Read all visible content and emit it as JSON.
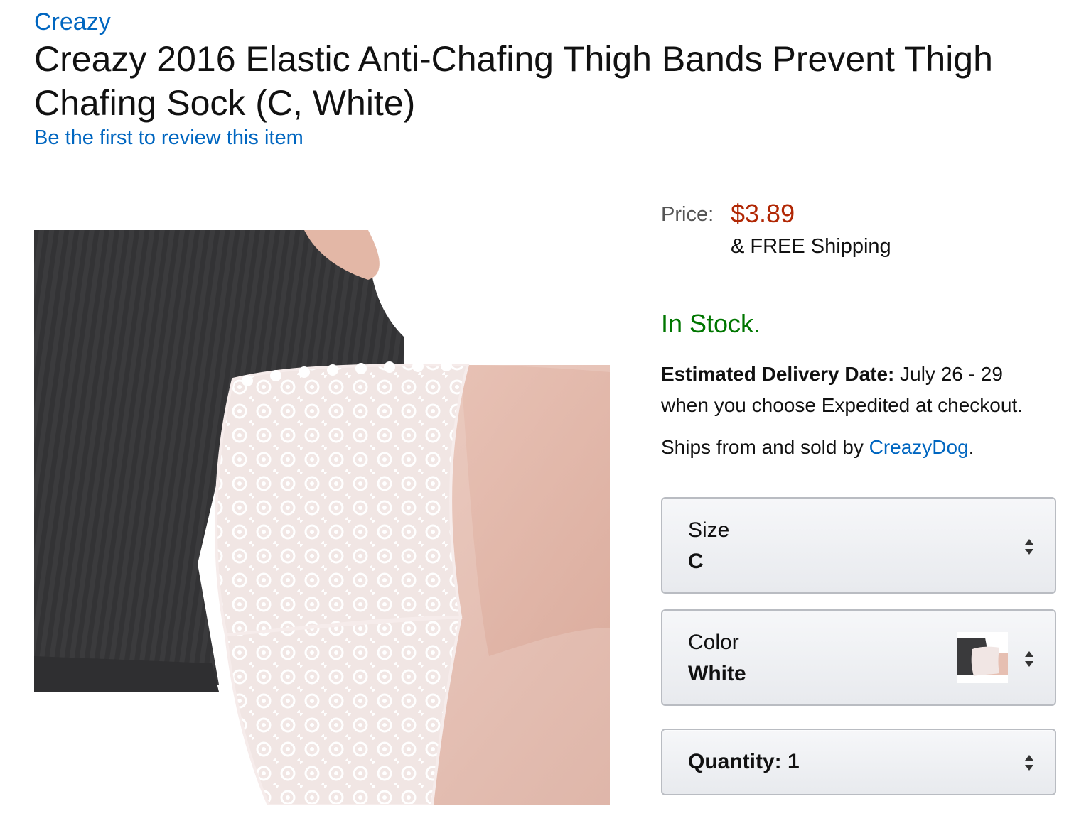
{
  "product": {
    "brand": "Creazy",
    "title": "Creazy 2016 Elastic Anti-Chafing Thigh Bands Prevent Thigh Chafing Sock (C, White)",
    "review_link": "Be the first to review this item",
    "image_alt": "lace thigh band on leg"
  },
  "buybox": {
    "price_label": "Price:",
    "price": "$3.89",
    "shipping": "& FREE Shipping",
    "stock": "In Stock.",
    "delivery_label": "Estimated Delivery Date:",
    "delivery_dates": "July 26 - 29",
    "delivery_note": "when you choose Expedited at checkout.",
    "seller_prefix": "Ships from and sold by",
    "seller_name": "CreazyDog",
    "seller_suffix": "."
  },
  "options": {
    "size": {
      "label": "Size",
      "value": "C"
    },
    "color": {
      "label": "Color",
      "value": "White"
    },
    "quantity": {
      "label": "Quantity:",
      "value": "1"
    }
  },
  "colors": {
    "link": "#0066c0",
    "price": "#b12704",
    "stock": "#007600"
  },
  "icons": {
    "stepper": "up-down-chevron-icon"
  }
}
